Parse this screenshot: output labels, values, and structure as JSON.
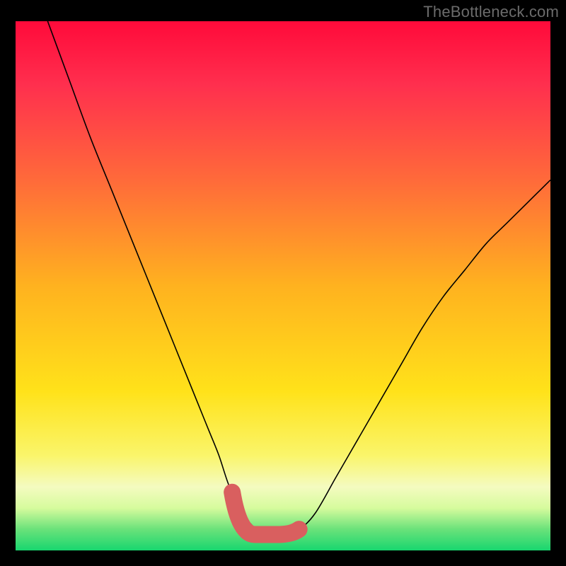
{
  "watermark": "TheBottleneck.com",
  "colors": {
    "curve": "#000000",
    "trough": "#d95f5f",
    "frame": "#000000"
  },
  "chart_data": {
    "type": "line",
    "title": "",
    "xlabel": "",
    "ylabel": "",
    "x_range": [
      0,
      100
    ],
    "y_range": [
      0,
      100
    ],
    "series": [
      {
        "name": "curve",
        "x": [
          6,
          10,
          14,
          18,
          22,
          26,
          30,
          34,
          36,
          38,
          40,
          42.5,
          45,
          47.5,
          50,
          53,
          56,
          60,
          64,
          68,
          72,
          76,
          80,
          84,
          88,
          92,
          96,
          100
        ],
        "y": [
          100,
          89,
          78,
          68,
          58,
          48,
          38,
          28,
          23,
          18,
          12,
          7,
          4,
          3,
          3,
          4,
          7,
          14,
          21,
          28,
          35,
          42,
          48,
          53,
          58,
          62,
          66,
          70
        ]
      }
    ],
    "optimal_band": {
      "x_start": 40.5,
      "x_end": 53,
      "y_floor": 3
    },
    "background_gradient_stops": [
      {
        "offset": 0.0,
        "color": "#ff0a3a"
      },
      {
        "offset": 0.12,
        "color": "#ff2f4e"
      },
      {
        "offset": 0.3,
        "color": "#ff6a3a"
      },
      {
        "offset": 0.5,
        "color": "#ffb21f"
      },
      {
        "offset": 0.7,
        "color": "#ffe21a"
      },
      {
        "offset": 0.82,
        "color": "#faf56a"
      },
      {
        "offset": 0.88,
        "color": "#f4fbc0"
      },
      {
        "offset": 0.92,
        "color": "#d6fb9d"
      },
      {
        "offset": 0.96,
        "color": "#6ae27a"
      },
      {
        "offset": 1.0,
        "color": "#18d66f"
      }
    ]
  }
}
